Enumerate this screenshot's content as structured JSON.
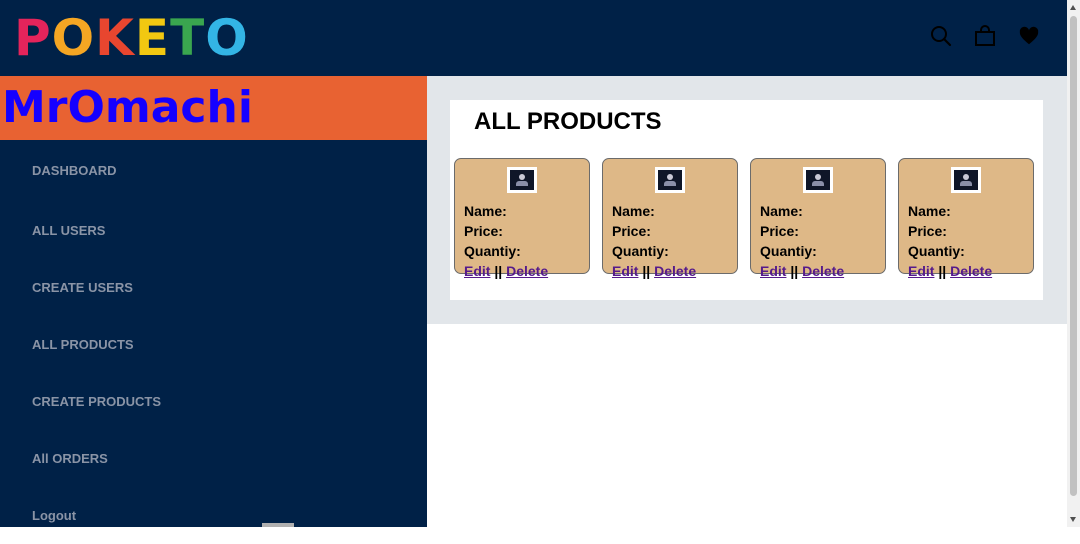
{
  "header": {
    "logo_letters": [
      {
        "char": "P",
        "color": "#e4245b"
      },
      {
        "char": "O",
        "color": "#f5a623"
      },
      {
        "char": "K",
        "color": "#e8462f"
      },
      {
        "char": "E",
        "color": "#f2c811"
      },
      {
        "char": "T",
        "color": "#3aa64f"
      },
      {
        "char": "O",
        "color": "#33b5e5"
      }
    ],
    "icons": [
      "search-icon",
      "shopping-bag-icon",
      "heart-icon"
    ]
  },
  "sidebar": {
    "brand": "MrOmachi",
    "items": [
      {
        "label": "DASHBOARD"
      },
      {
        "label": "ALL USERS"
      },
      {
        "label": "CREATE USERS"
      },
      {
        "label": "ALL PRODUCTS"
      },
      {
        "label": "CREATE PRODUCTS"
      },
      {
        "label": "All ORDERS"
      },
      {
        "label": "Logout"
      }
    ]
  },
  "main": {
    "title": "ALL PRODUCTS",
    "cards": [
      {
        "name_label": "Name:",
        "price_label": "Price:",
        "quantity_label": "Quantiy:",
        "edit": "Edit",
        "separator": "||",
        "delete": "Delete"
      },
      {
        "name_label": "Name:",
        "price_label": "Price:",
        "quantity_label": "Quantiy:",
        "edit": "Edit",
        "separator": "||",
        "delete": "Delete"
      },
      {
        "name_label": "Name:",
        "price_label": "Price:",
        "quantity_label": "Quantiy:",
        "edit": "Edit",
        "separator": "||",
        "delete": "Delete"
      },
      {
        "name_label": "Name:",
        "price_label": "Price:",
        "quantity_label": "Quantiy:",
        "edit": "Edit",
        "separator": "||",
        "delete": "Delete"
      }
    ]
  },
  "colors": {
    "navy": "#002147",
    "brand_bg": "#e86232",
    "brand_text": "#1500ff",
    "card_bg": "#deb887",
    "link": "#551a8b"
  }
}
